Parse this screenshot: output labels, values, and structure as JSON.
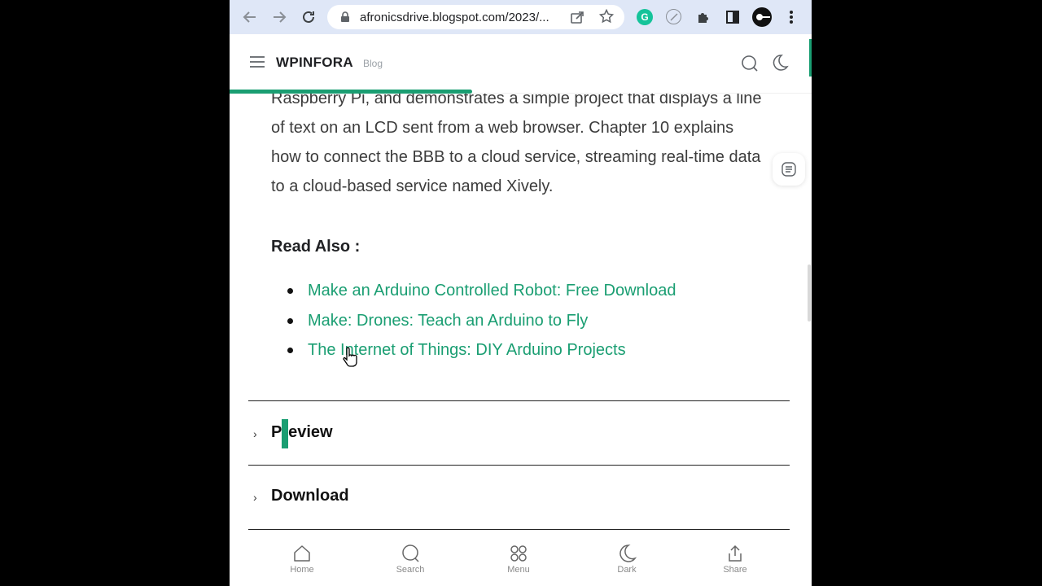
{
  "browser": {
    "url": "afronicsdrive.blogspot.com/2023/...",
    "colors": {
      "toolbar": "#dfe7f7",
      "accent": "#1a9e72"
    }
  },
  "site": {
    "brand": "WPINFORA",
    "brand_tag": "Blog"
  },
  "article": {
    "paragraph": "Raspberry Pi, and demonstrates a simple project that displays a line of text on an LCD sent from a web browser. Chapter 10 explains how to connect the BBB to a cloud service, streaming real-time data to a cloud-based service named Xively.",
    "read_also_heading": "Read Also :",
    "read_also_links": [
      "Make an Arduino Controlled Robot: Free Download",
      "Make: Drones: Teach an Arduino to Fly",
      "The Internet of Things: DIY Arduino Projects"
    ]
  },
  "accordions": {
    "preview": "Preview",
    "download": "Download"
  },
  "bottom_nav": {
    "home": "Home",
    "search": "Search",
    "menu": "Menu",
    "dark": "Dark",
    "share": "Share"
  }
}
